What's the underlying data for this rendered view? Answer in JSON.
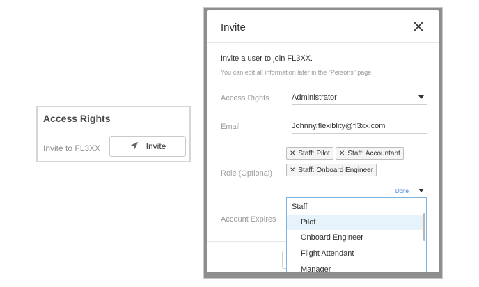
{
  "left_card": {
    "title": "Access Rights",
    "invite_label": "Invite to FL3XX",
    "invite_button": "Invite",
    "invite_icon": "send-icon"
  },
  "modal": {
    "title": "Invite",
    "close_icon": "close-icon",
    "intro": "Invite a user to join FL3XX.",
    "intro_sub": "You can edit all information later in the “Persons” page.",
    "fields": {
      "access_rights": {
        "label": "Access Rights",
        "value": "Administrator"
      },
      "email": {
        "label": "Email",
        "value": "Johnny.flexiblity@fl3xx.com"
      },
      "role": {
        "label": "Role (Optional)",
        "tags": [
          "Staff: Pilot",
          "Staff: Accountant",
          "Staff: Onboard Engineer"
        ],
        "done_label": "Done"
      },
      "account_expires": {
        "label": "Account Expires"
      }
    },
    "dropdown": {
      "group": "Staff",
      "options": [
        "Pilot",
        "Onboard Engineer",
        "Flight Attendant",
        "Manager"
      ],
      "highlighted": "Pilot"
    }
  },
  "colors": {
    "accent": "#3b7fd6",
    "highlight": "#e6f3fa",
    "frame": "#8e8e8e"
  }
}
